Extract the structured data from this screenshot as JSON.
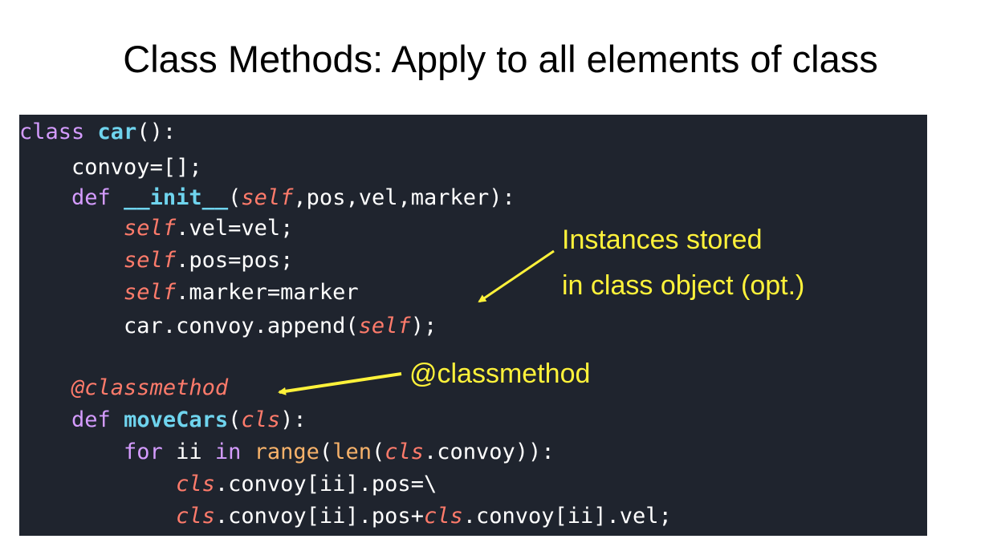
{
  "slide": {
    "title": "Class Methods: Apply to all elements of class"
  },
  "code": {
    "l1": {
      "kw": "class",
      "sp": " ",
      "name": "car",
      "rest": "():"
    },
    "l2": {
      "indent": "    ",
      "text": "convoy=[];"
    },
    "l3": {
      "indent": "    ",
      "kw": "def",
      "sp": " ",
      "name": "__init__",
      "open": "(",
      "self": "self",
      "rest": ",pos,vel,marker):"
    },
    "l4": {
      "indent": "        ",
      "self": "self",
      "rest": ".vel=vel;"
    },
    "l5": {
      "indent": "        ",
      "self": "self",
      "rest": ".pos=pos;"
    },
    "l6": {
      "indent": "        ",
      "self": "self",
      "rest": ".marker=marker"
    },
    "l7": {
      "indent": "        ",
      "pre": "car.convoy.append(",
      "self": "self",
      "rest": ");"
    },
    "l8": {
      "indent": "    ",
      "decorator": "@classmethod"
    },
    "l9": {
      "indent": "    ",
      "kw": "def",
      "sp": " ",
      "name": "moveCars",
      "open": "(",
      "cls": "cls",
      "rest": "):"
    },
    "l10": {
      "indent": "        ",
      "kw1": "for",
      "mid1": " ii ",
      "kw2": "in",
      "sp": " ",
      "b1": "range",
      "p1": "(",
      "b2": "len",
      "p2": "(",
      "cls": "cls",
      "rest": ".convoy)):"
    },
    "l11": {
      "indent": "            ",
      "cls": "cls",
      "rest": ".convoy[ii].pos=\\"
    },
    "l12": {
      "indent": "            ",
      "cls1": "cls",
      "mid": ".convoy[ii].pos+",
      "cls2": "cls",
      "rest": ".convoy[ii].vel;"
    }
  },
  "annotations": {
    "instances_line1": "Instances stored",
    "instances_line2": "in class object (opt.)",
    "classmethod": "@classmethod"
  },
  "colors": {
    "panel_bg": "#1f242e",
    "keyword": "#d59cff",
    "function_name": "#6fd4ee",
    "self_cls": "#ff7b6b",
    "builtin": "#f7b26a",
    "annotation": "#fff23a"
  }
}
